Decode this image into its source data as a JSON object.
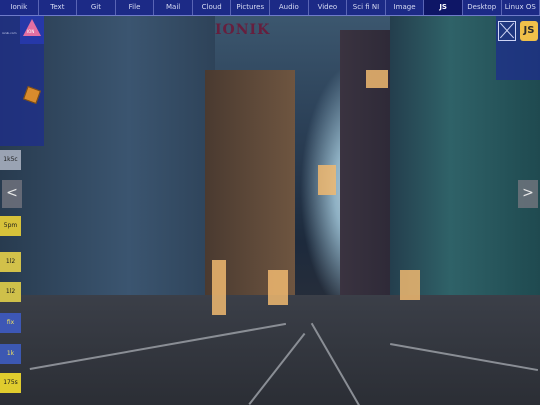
{
  "tabs": [
    {
      "label": "Ionik"
    },
    {
      "label": "Text"
    },
    {
      "label": "Git"
    },
    {
      "label": "File"
    },
    {
      "label": "Mail"
    },
    {
      "label": "Cloud"
    },
    {
      "label": "Pictures"
    },
    {
      "label": "Audio"
    },
    {
      "label": "Video"
    },
    {
      "label": "Sci fi NI"
    },
    {
      "label": "Image"
    },
    {
      "label": "JS"
    },
    {
      "label": "Desktop"
    },
    {
      "label": "Linux OS"
    }
  ],
  "active_tab": "JS",
  "overlay_title": "IONIK",
  "logo_text": "ION",
  "left_small_label": "ionik.com",
  "side_left_button": "<",
  "side_right_button": ">",
  "js_badge": "JS",
  "left_chips": [
    {
      "label": "1k5c",
      "color": "#9aa3b3"
    },
    {
      "label": "5pm",
      "color": "#d7c23a"
    },
    {
      "label": "1l2",
      "color": "#d2c14a"
    },
    {
      "label": "1l2",
      "color": "#cfc04a"
    },
    {
      "label": "fix",
      "color": "#3d57b5"
    },
    {
      "label": "1k",
      "color": "#3c58b2"
    },
    {
      "label": "175s",
      "color": "#e0cc2e"
    }
  ],
  "colors": {
    "topbar": "#1c2a86",
    "active_tab": "#0e1666",
    "panel": "#1e2d8c",
    "js_badge": "#f0c04a"
  }
}
